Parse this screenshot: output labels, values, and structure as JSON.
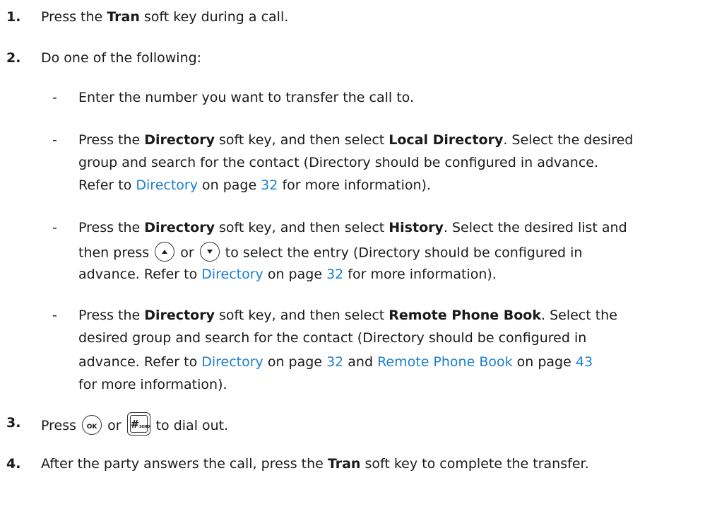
{
  "steps": [
    {
      "num": "1.",
      "pre": "Press the ",
      "key": "Tran",
      "post": " soft key during a call."
    },
    {
      "num": "2.",
      "text": "Do one of the following:"
    },
    {
      "num": "3.",
      "pre": "Press ",
      "or": " or ",
      "post": " to dial out."
    },
    {
      "num": "4.",
      "pre": "After the party answers the call, press the ",
      "key": "Tran",
      "post": " soft key to complete the transfer."
    }
  ],
  "options": {
    "dash": "-",
    "a": {
      "text": "Enter the number you want to transfer the call to."
    },
    "b": {
      "l1_pre": "Press the ",
      "l1_key1": "Directory",
      "l1_mid": " soft key, and then select ",
      "l1_key2": "Local Directory",
      "l1_post": ". Select the desired",
      "l2": "group and search for the contact (Directory should be configured in advance.",
      "l3_pre": "Refer to ",
      "l3_link": "Directory",
      "l3_mid": " on page ",
      "l3_page": "32",
      "l3_post": " for more information)."
    },
    "c": {
      "l1_pre": "Press the ",
      "l1_key1": "Directory",
      "l1_mid": " soft key, and then select ",
      "l1_key2": "History",
      "l1_post": ". Select the desired list and",
      "l2_pre": "then press ",
      "l2_or": " or ",
      "l2_post": " to select the entry (Directory should be configured in",
      "l3_pre": "advance. Refer to ",
      "l3_link": "Directory",
      "l3_mid": " on page ",
      "l3_page": "32",
      "l3_post": " for more information)."
    },
    "d": {
      "l1_pre": "Press the ",
      "l1_key1": "Directory",
      "l1_mid": " soft key, and then select ",
      "l1_key2": "Remote Phone Book",
      "l1_post": ". Select the",
      "l2": "desired group and search for the contact (Directory should be configured in",
      "l3_pre": "advance. Refer to ",
      "l3_link": "Directory",
      "l3_mid": " on page ",
      "l3_page": "32",
      "l3_and": " and ",
      "l3_link2": "Remote Phone Book",
      "l3_mid2": " on page ",
      "l3_page2": "43",
      "l4": "for more information)."
    }
  },
  "keys": {
    "up_icon": "up-arrow-key-icon",
    "down_icon": "down-arrow-key-icon",
    "ok_label": "OK",
    "send_hash": "#",
    "send_label": "SEND"
  },
  "colors": {
    "link": "#1a7fd0",
    "text": "#1a1a1a"
  }
}
